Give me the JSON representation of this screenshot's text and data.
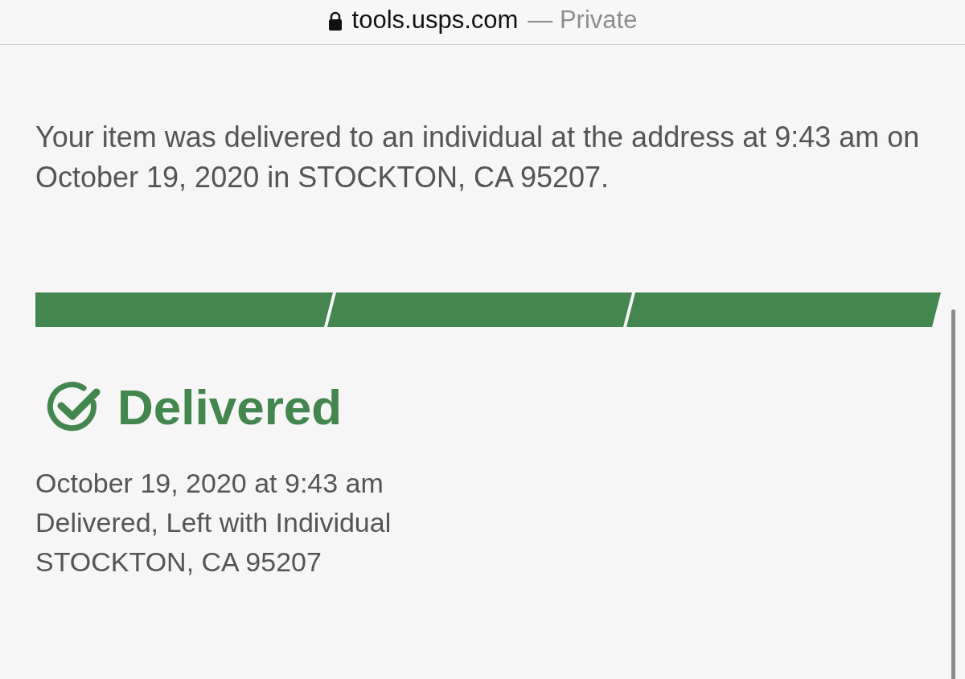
{
  "address_bar": {
    "domain": "tools.usps.com",
    "mode": "— Private",
    "secure": true
  },
  "message": "Your item was delivered to an individual at the address at 9:43 am on October 19, 2020 in STOCKTON, CA 95207.",
  "progress": [
    {
      "complete": true
    },
    {
      "complete": true
    },
    {
      "complete": true
    }
  ],
  "status": {
    "title": "Delivered",
    "checked": true
  },
  "details": [
    "October 19, 2020 at 9:43 am",
    "Delivered, Left with Individual",
    "STOCKTON, CA 95207"
  ]
}
